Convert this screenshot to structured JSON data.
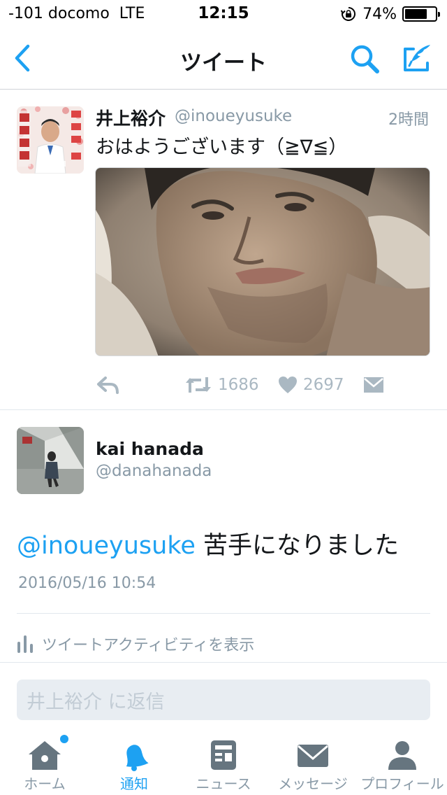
{
  "status_bar": {
    "carrier": "-101 docomo",
    "network": "LTE",
    "time": "12:15",
    "battery_percent": "74%",
    "battery_level": 0.74
  },
  "nav": {
    "title": "ツイート",
    "back_icon": "chevron-left-icon",
    "search_icon": "search-icon",
    "compose_icon": "compose-tweet-icon"
  },
  "parent_tweet": {
    "display_name": "井上裕介",
    "handle": "@inoueyusuke",
    "time_ago": "2時間",
    "text": "おはようございます（≧∇≦）",
    "retweets": "1686",
    "likes": "2697"
  },
  "focused_tweet": {
    "display_name": "kai hanada",
    "handle": "@danahanada",
    "mention": "@inoueyusuke",
    "text": " 苦手になりました",
    "timestamp": "2016/05/16 10:54",
    "activity_label": "ツイートアクティビティを表示"
  },
  "reply": {
    "placeholder": "井上裕介 に返信"
  },
  "tabs": [
    {
      "label": "ホーム",
      "icon": "home-icon",
      "active": false,
      "has_dot": true
    },
    {
      "label": "通知",
      "icon": "bell-icon",
      "active": true,
      "has_dot": false
    },
    {
      "label": "ニュース",
      "icon": "news-icon",
      "active": false,
      "has_dot": false
    },
    {
      "label": "メッセージ",
      "icon": "envelope-icon",
      "active": false,
      "has_dot": false
    },
    {
      "label": "プロフィール",
      "icon": "person-icon",
      "active": false,
      "has_dot": false
    }
  ],
  "colors": {
    "accent": "#1da1f2",
    "text_primary": "#14171a",
    "text_secondary": "#8899a6",
    "action_icon": "#aab8c2",
    "tab_icon": "#66757f"
  }
}
